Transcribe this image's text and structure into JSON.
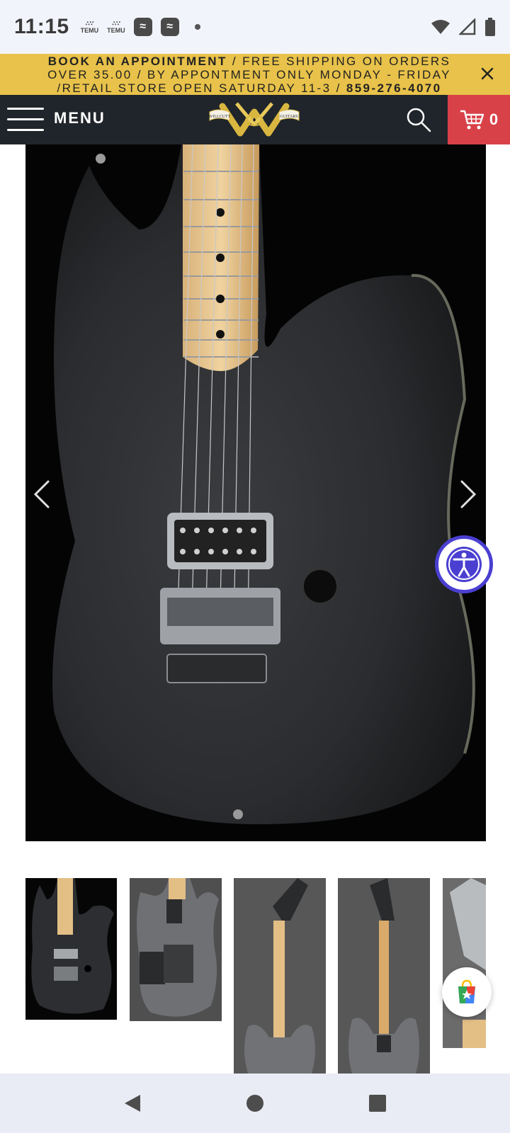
{
  "status_bar": {
    "time": "11:15",
    "apps": [
      {
        "name": "temu",
        "label": "TEMU"
      },
      {
        "name": "temu",
        "label": "TEMU"
      }
    ],
    "icons": [
      "wifi-icon",
      "signal-icon",
      "battery-icon"
    ]
  },
  "promo": {
    "bold_lead": "BOOK AN APPOINTMENT",
    "text": " / FREE SHIPPING ON ORDERS OVER 35.00 / BY APPONTMENT ONLY MONDAY - FRIDAY /RETAIL STORE OPEN SATURDAY 11-3 / ",
    "phone": "859-276-4070"
  },
  "header": {
    "menu_label": "MENU",
    "logo_text_left": "WILLCUTT",
    "logo_text_right": "GUITARS",
    "cart_count": "0"
  },
  "gallery": {
    "main_image_alt": "Black electric guitar body",
    "thumbnail_count": 5
  },
  "colors": {
    "promo_bg": "#e8c24a",
    "header_bg": "#20252b",
    "cart_bg": "#d94148",
    "a11y_accent": "#4a3fd1"
  }
}
